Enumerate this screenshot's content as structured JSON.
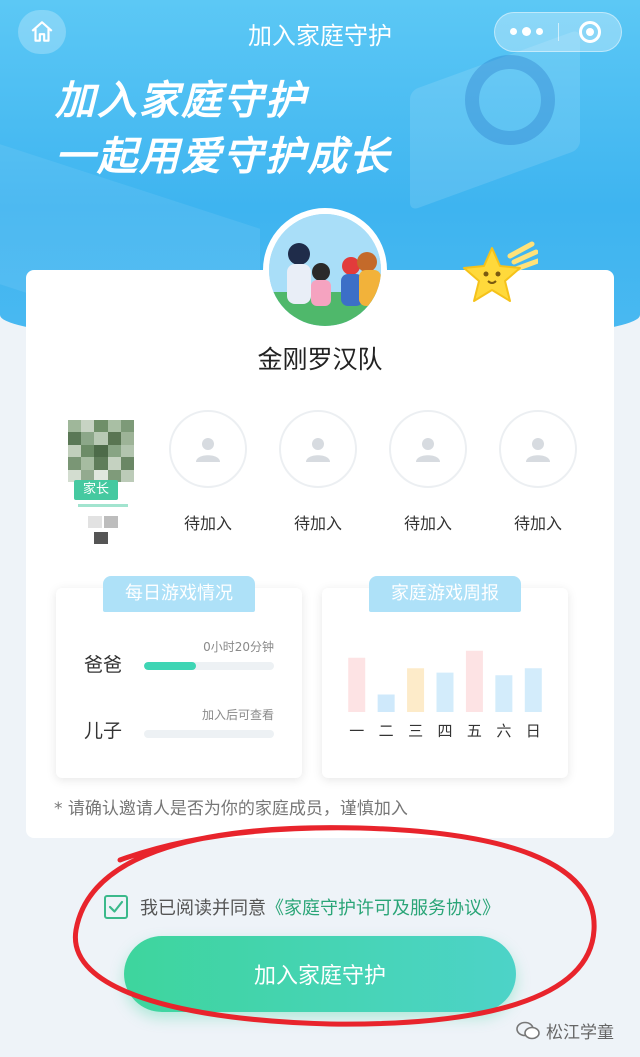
{
  "nav": {
    "title": "加入家庭守护",
    "home_icon": "home-icon",
    "more_icon": "more-dots-icon",
    "close_icon": "target-close-icon"
  },
  "hero": {
    "slogan_line1": "加入家庭守护",
    "slogan_line2": "一起用爱守护成长"
  },
  "team": {
    "name": "金刚罗汉队"
  },
  "members": {
    "parent": {
      "badge": "家长"
    },
    "pending": [
      {
        "label": "待加入"
      },
      {
        "label": "待加入"
      },
      {
        "label": "待加入"
      },
      {
        "label": "待加入"
      }
    ]
  },
  "daily": {
    "title": "每日游戏情况",
    "rows": [
      {
        "label": "爸爸",
        "note": "0小时20分钟",
        "progress": 0.4
      },
      {
        "label": "儿子",
        "note": "加入后可查看",
        "progress": 0
      }
    ]
  },
  "weekly": {
    "title": "家庭游戏周报"
  },
  "chart_data": {
    "type": "bar",
    "categories": [
      "一",
      "二",
      "三",
      "四",
      "五",
      "六",
      "日"
    ],
    "values": [
      62,
      20,
      50,
      45,
      70,
      42,
      50
    ],
    "colors": [
      "#fde3e4",
      "#cfe9fb",
      "#fdebc9",
      "#d3ecfb",
      "#fde3e4",
      "#d3ecfb",
      "#d3ecfb"
    ],
    "ylim": [
      0,
      80
    ]
  },
  "notice": "* 请确认邀请人是否为你的家庭成员，谨慎加入",
  "agreement": {
    "prefix": "我已阅读并同意",
    "link": "《家庭守护许可及服务协议》",
    "checked": true
  },
  "join_button": "加入家庭守护",
  "watermark": "松江学童",
  "colors": {
    "accent": "#3ed5a0",
    "hero": "#3eb4f0",
    "link": "#2aa577"
  }
}
